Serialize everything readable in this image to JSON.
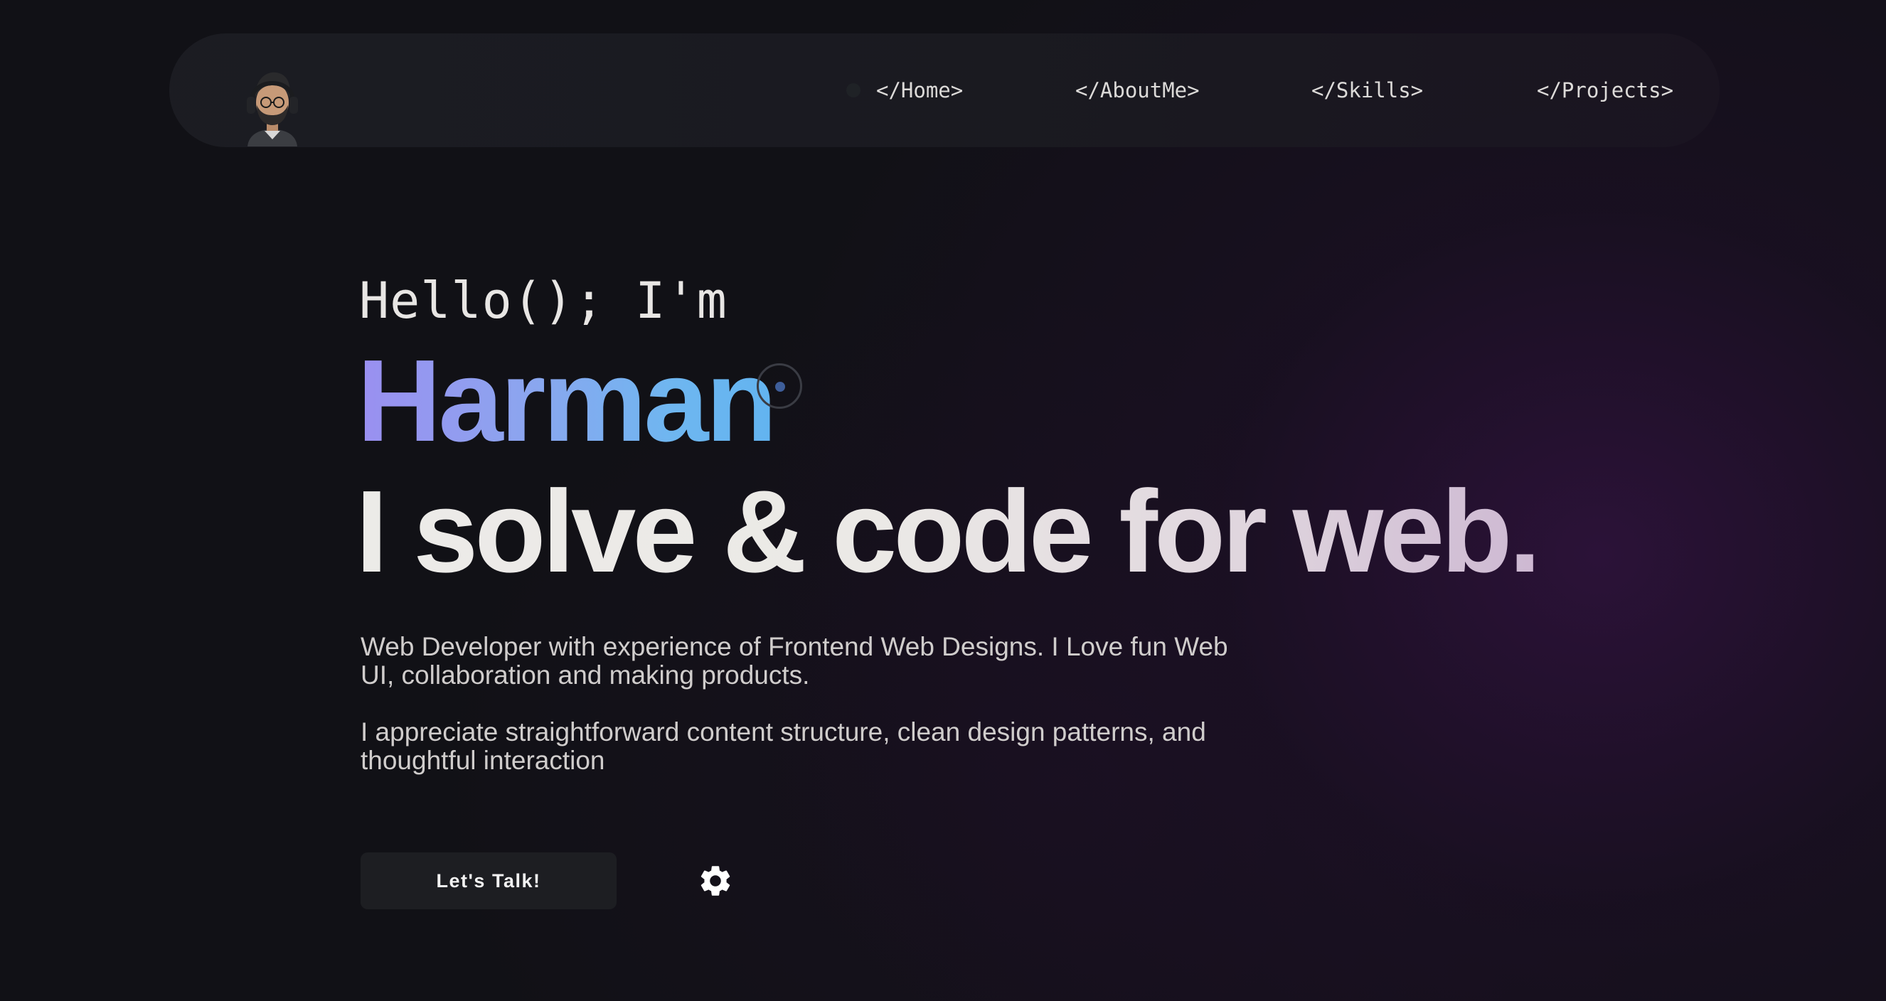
{
  "nav": {
    "avatar": "avatar-icon",
    "links": [
      {
        "label": "</Home>"
      },
      {
        "label": "</AboutMe>"
      },
      {
        "label": "</Skills>"
      },
      {
        "label": "</Projects>"
      }
    ]
  },
  "hero": {
    "greeting": "Hello(); I'm",
    "name": "Harman",
    "tagline": "I solve & code for web.",
    "paragraphs": [
      "Web Developer with experience of Frontend Web Designs. I Love fun Web UI, collaboration and making products.",
      "I appreciate straightforward content structure, clean design patterns, and thoughtful interaction"
    ],
    "cta_label": "Let's Talk!",
    "settings_icon": "gear-icon"
  },
  "colors": {
    "background": "#111116",
    "name_gradient_start": "#9a8ff0",
    "name_gradient_end": "#62b4f0",
    "button_bg": "#1d1e22"
  }
}
